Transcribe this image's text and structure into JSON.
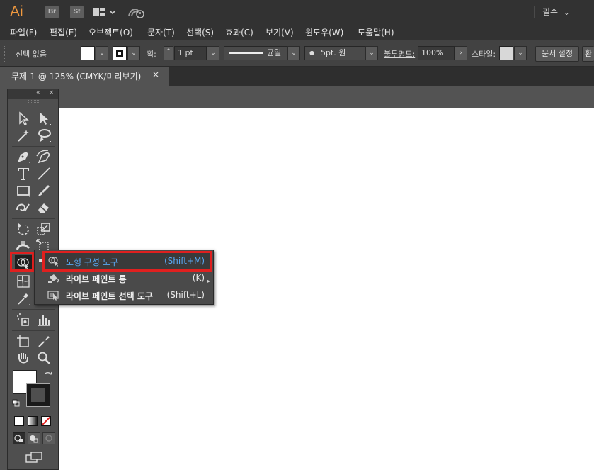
{
  "titlebar": {
    "app_logo": "Ai",
    "bridge_label": "Br",
    "stock_label": "St",
    "workspace": "필수",
    "workspace_chevron": "⌄"
  },
  "menubar": {
    "items": [
      "파일(F)",
      "편집(E)",
      "오브젝트(O)",
      "문자(T)",
      "선택(S)",
      "효과(C)",
      "보기(V)",
      "윈도우(W)",
      "도움말(H)"
    ]
  },
  "controlbar": {
    "selection_status": "선택 없음",
    "stroke_label": "획:",
    "stroke_weight": "1 pt",
    "stroke_profile": "균일",
    "brush_dot": "●",
    "brush": "5pt. 원",
    "opacity_label": "불투명도:",
    "opacity": "100%",
    "style_label": "스타일:",
    "doc_setup_button": "문서 설정",
    "prefs_button_partial": "환",
    "fill_color": "#ffffff",
    "style_swatch_color": "#d8d8d8",
    "dropdown_glyph": "⌄",
    "spinner_glyph": "⌃",
    "forward_glyph": "›"
  },
  "tabbar": {
    "document_title": "무제-1 @ 125% (CMYK/미리보기)",
    "close_glyph": "×"
  },
  "toolpanel": {
    "collapse_glyph": "«",
    "close_glyph": "×"
  },
  "flyout": {
    "items": [
      {
        "label": "도형 구성 도구",
        "shortcut": "(Shift+M)",
        "icon": "shape-builder-icon",
        "highlighted": true
      },
      {
        "label": "라이브 페인트 통",
        "shortcut": "(K)",
        "icon": "live-paint-bucket-icon",
        "highlighted": false
      },
      {
        "label": "라이브 페인트 선택 도구",
        "shortcut": "(Shift+L)",
        "icon": "live-paint-selection-icon",
        "highlighted": false
      }
    ]
  },
  "colors": {
    "highlight_text": "#58a6ef",
    "callout_red": "#e0201f",
    "ai_orange": "#f29a3f"
  }
}
